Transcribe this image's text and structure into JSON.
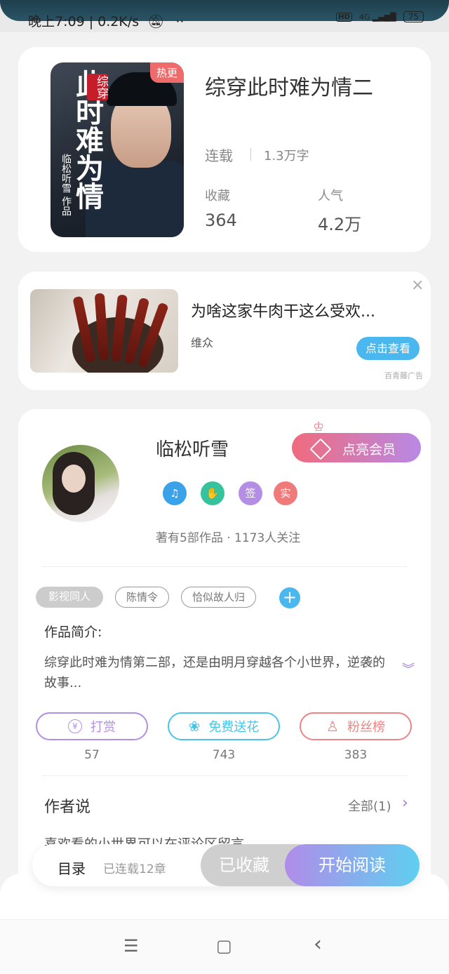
{
  "status_bar": {
    "time_speed": "晚上7:09 | 0.2K/s",
    "dnd_icon": "bell-off-icon",
    "more": "··",
    "hd": "HD",
    "network": "4G",
    "battery": "75"
  },
  "book": {
    "cover_badge": "热更",
    "cover_tag": "综穿",
    "cover_title_art": "此时难为情",
    "cover_author": "临松听雪 作品",
    "title": "综穿此时难为情二",
    "status": "连载",
    "word_count": "1.3万字",
    "stats": [
      {
        "label": "收藏",
        "value": "364"
      },
      {
        "label": "人气",
        "value": "4.2万"
      }
    ]
  },
  "ad": {
    "title": "为啥这家牛肉干这么受欢...",
    "advertiser": "维众",
    "cta": "点击查看",
    "close": "×",
    "network": "百青藤广告"
  },
  "author": {
    "name": "临松听雪",
    "vip_button": "点亮会员",
    "badges": [
      {
        "icon": "music-note-badge-icon",
        "text": "♫",
        "color": "#3aa2e8"
      },
      {
        "icon": "handshake-badge-icon",
        "text": "✋",
        "color": "#34c39c"
      },
      {
        "icon": "sign-badge-icon",
        "text": "签",
        "color": "#b48ee4"
      },
      {
        "icon": "verified-badge-icon",
        "text": "实",
        "color": "#f07a7a"
      }
    ],
    "meta": "著有5部作品 · 1173人关注"
  },
  "tags": [
    "影视同人",
    "陈情令",
    "恰似故人归"
  ],
  "intro": {
    "label": "作品简介:",
    "text": "综穿此时难为情第二部，还是由明月穿越各个小世界，逆袭的故事..."
  },
  "actions": [
    {
      "label": "打赏",
      "count": "57",
      "icon": "yen-icon",
      "glyph": "¥",
      "color": "#b48ee4"
    },
    {
      "label": "免费送花",
      "count": "743",
      "icon": "flower-icon",
      "glyph": "❀",
      "color": "#49c4e6"
    },
    {
      "label": "粉丝榜",
      "count": "383",
      "icon": "user-icon",
      "glyph": "♙",
      "color": "#ec8585"
    }
  ],
  "author_says": {
    "title": "作者说",
    "all": "全部(1)",
    "preview": "喜欢看的小世界可以在评论区留言"
  },
  "bottom_bar": {
    "toc": "目录",
    "toc_sub": "已连载12章",
    "favorited": "已收藏",
    "start_reading": "开始阅读"
  },
  "nav": {
    "menu": "☰",
    "home": "▢",
    "back": "‹"
  }
}
